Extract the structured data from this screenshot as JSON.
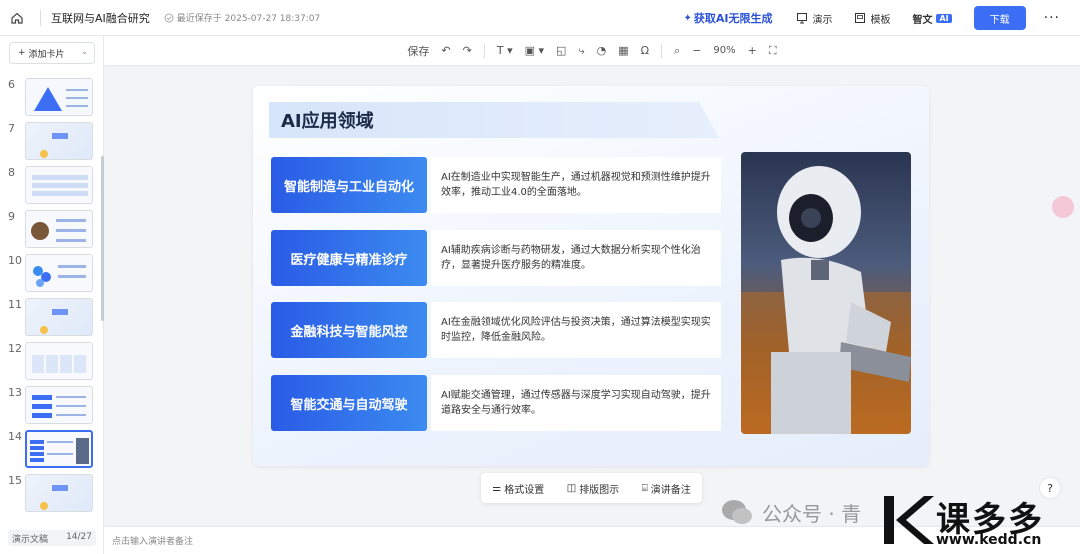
{
  "topbar": {
    "doc_title": "互联网与AI融合研究",
    "save_status": "最近保存于 2025-07-27 18:37:07",
    "ai_generate": "获取AI无限生成",
    "present": "演示",
    "templates": "模板",
    "smart_doc": "智文",
    "ai_badge": "AI",
    "download": "下载",
    "more": "···"
  },
  "sidebar": {
    "add_card": "添加卡片",
    "thumbnails": [
      {
        "num": "6"
      },
      {
        "num": "7"
      },
      {
        "num": "8"
      },
      {
        "num": "9"
      },
      {
        "num": "10"
      },
      {
        "num": "11"
      },
      {
        "num": "12"
      },
      {
        "num": "13"
      },
      {
        "num": "14"
      },
      {
        "num": "15"
      }
    ],
    "footer_label": "演示文稿",
    "footer_page": "14/27"
  },
  "toolbar": {
    "save": "保存",
    "zoom": "90%"
  },
  "slide": {
    "title": "AI应用领域",
    "items": [
      {
        "label": "智能制造与工业自动化",
        "desc": "AI在制造业中实现智能生产，通过机器视觉和预测性维护提升效率，推动工业4.0的全面落地。"
      },
      {
        "label": "医疗健康与精准诊疗",
        "desc": "AI辅助疾病诊断与药物研发，通过大数据分析实现个性化治疗，显著提升医疗服务的精准度。"
      },
      {
        "label": "金融科技与智能风控",
        "desc": "AI在金融领域优化风险评估与投资决策，通过算法模型实现实时监控，降低金融风险。"
      },
      {
        "label": "智能交通与自动驾驶",
        "desc": "AI赋能交通管理，通过传感器与深度学习实现自动驾驶，提升道路安全与通行效率。"
      }
    ]
  },
  "floatbar": {
    "format": "格式设置",
    "layout": "排版图示",
    "notes": "演讲备注"
  },
  "notes_placeholder": "点击输入演讲者备注",
  "help": "?",
  "watermark": {
    "text": "公众号 · 青",
    "brand": "课多多",
    "url": "www.kedd.cn"
  },
  "colors": {
    "accent": "#3b6ef5",
    "label_gradient_start": "#2a5be6",
    "label_gradient_end": "#3c8bf0"
  }
}
